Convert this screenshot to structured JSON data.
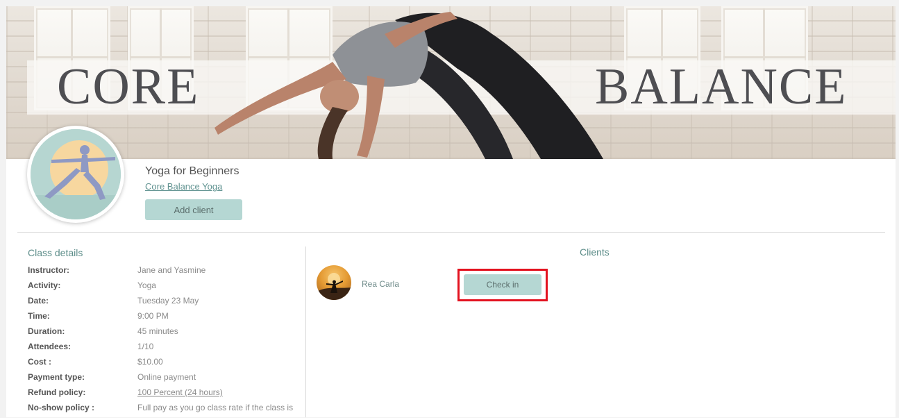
{
  "banner": {
    "title_left": "CORE",
    "title_right": "BALANCE"
  },
  "class": {
    "title": "Yoga for Beginners",
    "studio_link": "Core Balance Yoga",
    "add_client_label": "Add client"
  },
  "details": {
    "heading": "Class details",
    "rows": [
      {
        "label": "Instructor:",
        "value": "Jane and Yasmine"
      },
      {
        "label": "Activity:",
        "value": "Yoga"
      },
      {
        "label": "Date:",
        "value": "Tuesday 23 May"
      },
      {
        "label": "Time:",
        "value": "9:00 PM"
      },
      {
        "label": "Duration:",
        "value": "45 minutes"
      },
      {
        "label": "Attendees:",
        "value": "1/10"
      },
      {
        "label": "Cost :",
        "value": "$10.00"
      },
      {
        "label": "Payment type:",
        "value": "Online payment"
      },
      {
        "label": "Refund policy:",
        "value": "100 Percent (24 hours)"
      },
      {
        "label": "No-show policy :",
        "value": "Full pay as you go class rate if the class is"
      }
    ]
  },
  "clients": {
    "heading": "Clients",
    "items": [
      {
        "name": "Rea Carla",
        "check_in_label": "Check in"
      }
    ]
  },
  "colors": {
    "accent": "#b5d7d3",
    "link": "#5f9290",
    "highlight": "#e3121f"
  }
}
